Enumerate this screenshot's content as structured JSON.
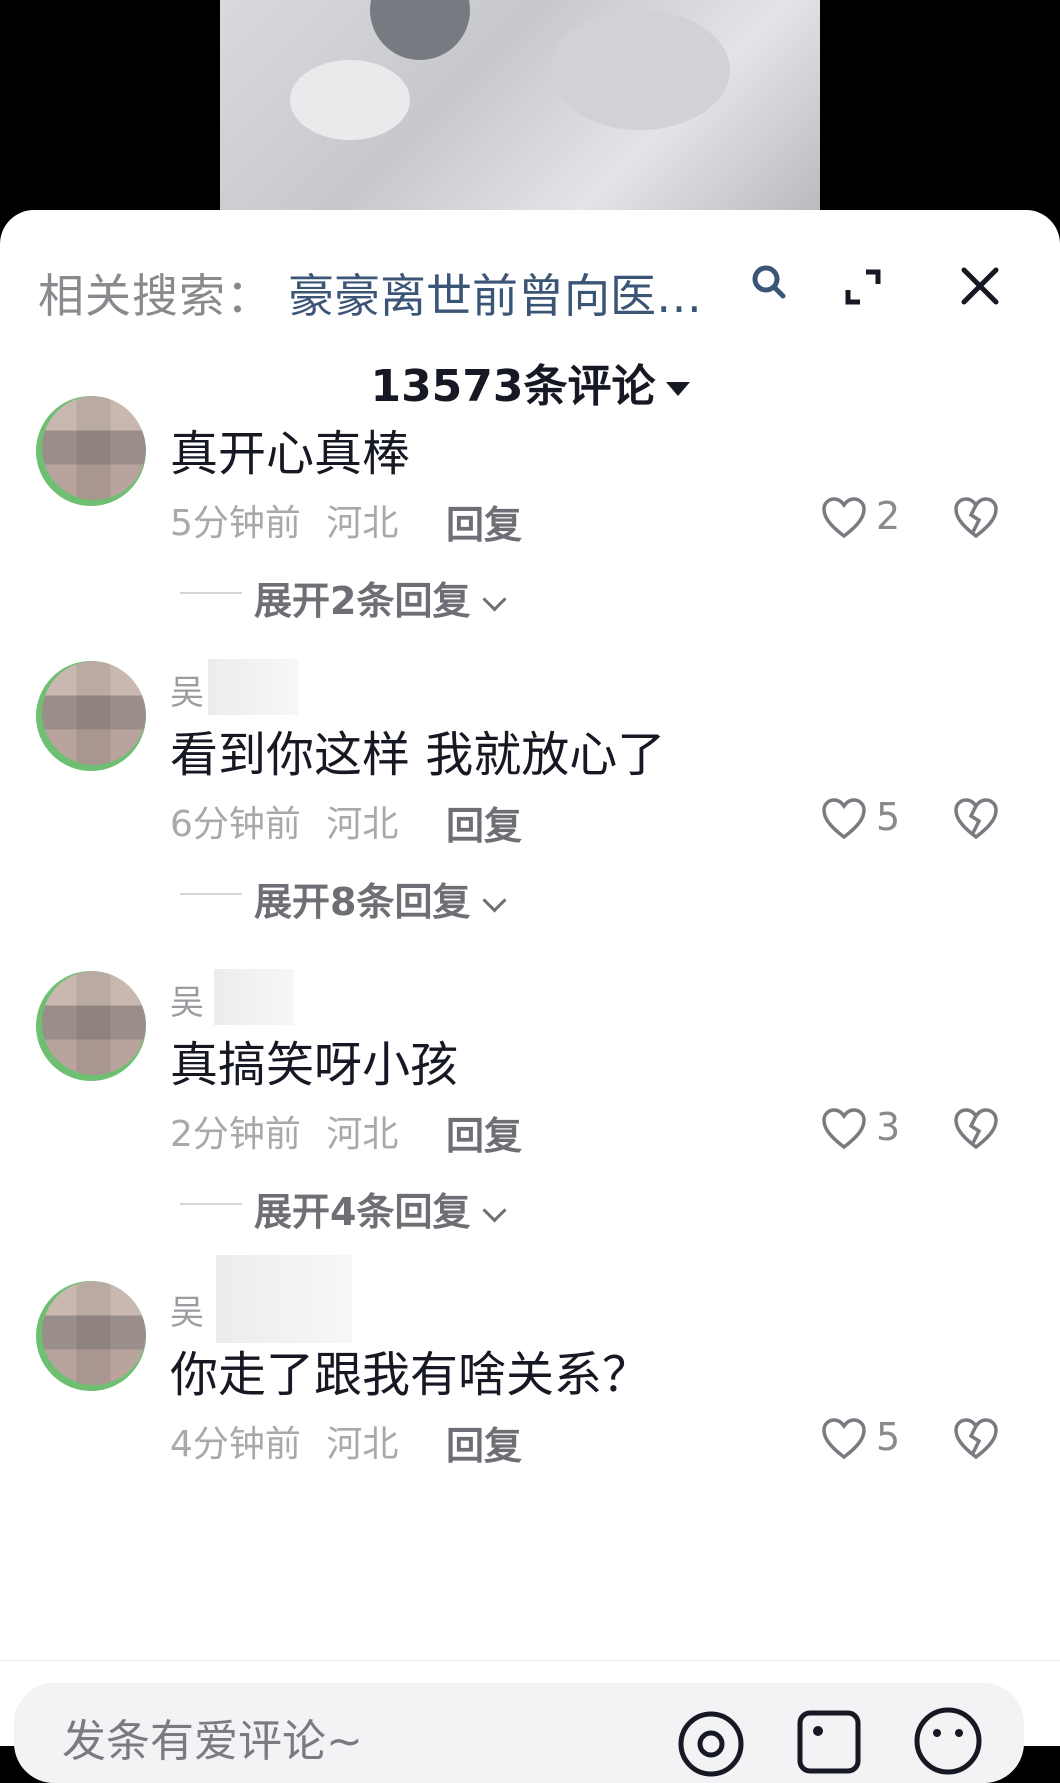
{
  "header": {
    "search_prefix": "相关搜索：",
    "search_query": "豪豪离世前曾向医…"
  },
  "comments_count_label": "13573条评论",
  "comments": [
    {
      "username": "",
      "text": "真开心真棒",
      "time": "5分钟前",
      "location": "河北",
      "reply_label": "回复",
      "likes": "2",
      "expand_label": "展开2条回复"
    },
    {
      "username": "吴",
      "text": "看到你这样 我就放心了",
      "time": "6分钟前",
      "location": "河北",
      "reply_label": "回复",
      "likes": "5",
      "expand_label": "展开8条回复"
    },
    {
      "username": "吴",
      "text": "真搞笑呀小孩",
      "time": "2分钟前",
      "location": "河北",
      "reply_label": "回复",
      "likes": "3",
      "expand_label": "展开4条回复"
    },
    {
      "username": "吴",
      "text": "你走了跟我有啥关系？",
      "time": "4分钟前",
      "location": "河北",
      "reply_label": "回复",
      "likes": "5",
      "expand_label": ""
    }
  ],
  "composer": {
    "placeholder": "发条有爱评论~"
  },
  "icons": {
    "search": "search-icon",
    "expand": "fullscreen-icon",
    "close": "close-icon",
    "like": "heart-icon",
    "dislike": "broken-heart-icon",
    "mention": "at-icon",
    "image": "image-icon",
    "emoji": "emoji-icon"
  },
  "colors": {
    "link": "#3b5577",
    "text": "#161823",
    "muted": "#a8a8ad"
  }
}
